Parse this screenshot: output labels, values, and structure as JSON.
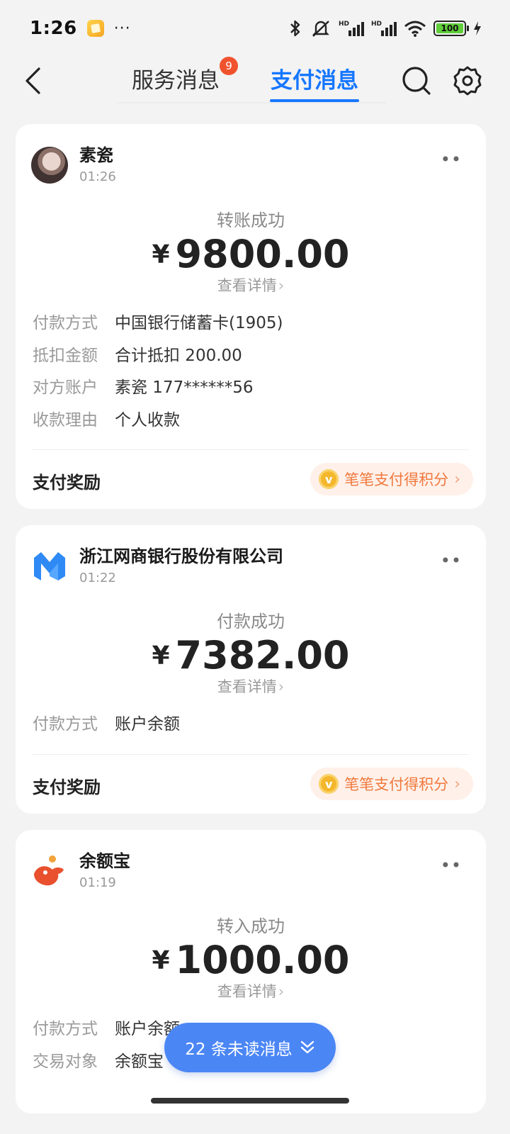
{
  "status_bar": {
    "time": "1:26",
    "dots": "···",
    "battery": "100"
  },
  "header": {
    "tab_service": "服务消息",
    "tab_service_badge": "9",
    "tab_pay": "支付消息"
  },
  "cards": [
    {
      "sender": "素瓷",
      "time": "01:26",
      "status": "转账成功",
      "currency": "¥",
      "amount": "9800.00",
      "detail_link": "查看详情",
      "rows": [
        {
          "key": "付款方式",
          "value": "中国银行储蓄卡(1905)"
        },
        {
          "key": "抵扣金额",
          "value": "合计抵扣 200.00"
        },
        {
          "key": "对方账户",
          "value": "素瓷 177******56"
        },
        {
          "key": "收款理由",
          "value": "个人收款"
        }
      ],
      "reward_label": "支付奖励",
      "reward_button": "笔笔支付得积分"
    },
    {
      "sender": "浙江网商银行股份有限公司",
      "time": "01:22",
      "status": "付款成功",
      "currency": "¥",
      "amount": "7382.00",
      "detail_link": "查看详情",
      "rows": [
        {
          "key": "付款方式",
          "value": "账户余额"
        }
      ],
      "reward_label": "支付奖励",
      "reward_button": "笔笔支付得积分"
    },
    {
      "sender": "余额宝",
      "time": "01:19",
      "status": "转入成功",
      "currency": "¥",
      "amount": "1000.00",
      "detail_link": "查看详情",
      "rows": [
        {
          "key": "付款方式",
          "value": "账户余额"
        },
        {
          "key": "交易对象",
          "value": "余额宝"
        }
      ]
    }
  ],
  "unread": {
    "label": "22 条未读消息"
  },
  "colors": {
    "accent": "#1677ff",
    "badge": "#f0522e",
    "reward_text": "#f0783c",
    "pill": "#4b86f5"
  },
  "icons": [
    "back-arrow-icon",
    "search-icon",
    "settings-gear-icon",
    "more-dots-icon",
    "coin-icon",
    "chevron-right-icon",
    "double-chevron-down-icon",
    "bluetooth-icon",
    "mute-icon",
    "signal-icon",
    "wifi-icon",
    "battery-icon",
    "charging-icon"
  ]
}
